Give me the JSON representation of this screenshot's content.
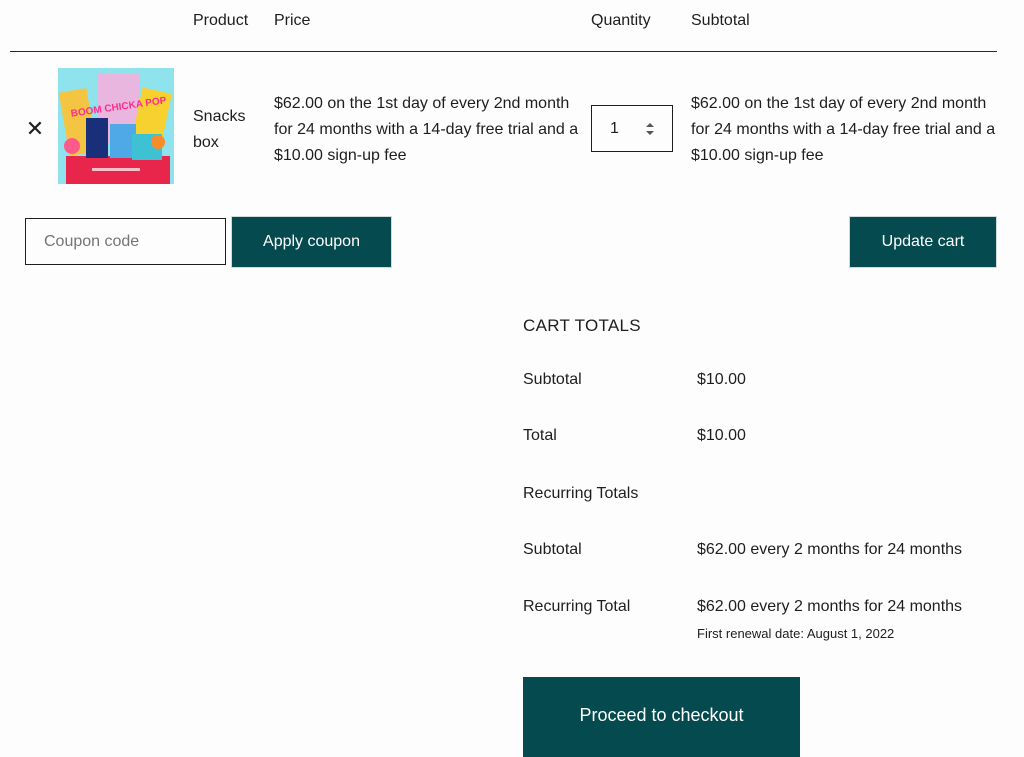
{
  "table": {
    "headers": {
      "product": "Product",
      "price": "Price",
      "quantity": "Quantity",
      "subtotal": "Subtotal"
    },
    "row": {
      "remove_icon": "close-icon",
      "remove_glyph": "✕",
      "product_name": "Snacks box",
      "price": "$62.00 on the 1st day of every 2nd month for 24 months with a 14-day free trial and a $10.00 sign-up fee",
      "quantity": "1",
      "subtotal": "$62.00 on the 1st day of every 2nd month for 24 months with a 14-day free trial and a $10.00 sign-up fee",
      "image_text": "BOOM CHICKA POP"
    }
  },
  "coupon": {
    "placeholder": "Coupon code",
    "apply_label": "Apply coupon"
  },
  "update_label": "Update cart",
  "cart_totals": {
    "title": "CART TOTALS",
    "subtotal_label": "Subtotal",
    "subtotal_value": "$10.00",
    "total_label": "Total",
    "total_value": "$10.00",
    "recurring_heading": "Recurring Totals",
    "recurring_subtotal_label": "Subtotal",
    "recurring_subtotal_value": "$62.00 every 2 months for 24 months",
    "recurring_total_label": "Recurring Total",
    "recurring_total_value": "$62.00 every 2 months for 24 months",
    "renewal_note": "First renewal date: August 1, 2022"
  },
  "checkout_label": "Proceed to checkout",
  "colors": {
    "button": "#044a4f",
    "button_text": "#ffffff"
  }
}
